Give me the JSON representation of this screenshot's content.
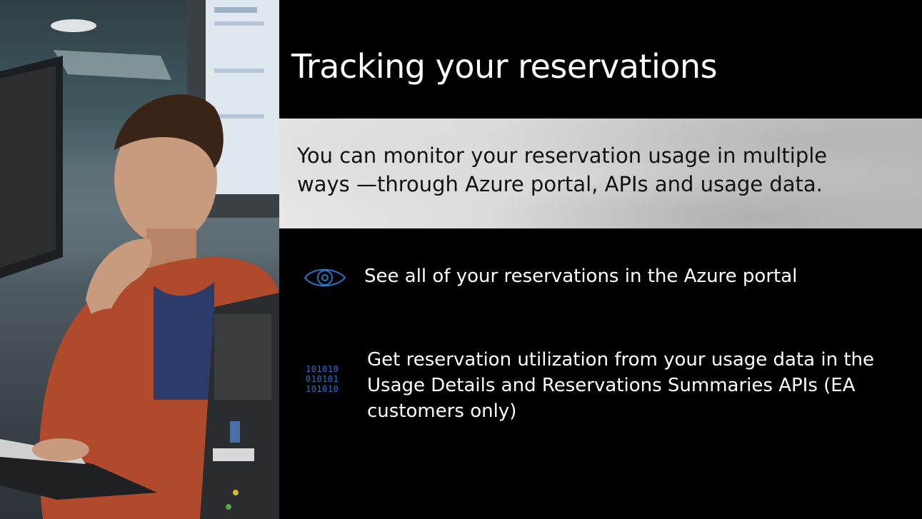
{
  "slide": {
    "title": "Tracking your reservations",
    "intro": "You can monitor your reservation usage in multiple ways —through Azure portal, APIs and usage data.",
    "items": [
      {
        "icon": "eye-icon",
        "text": "See all of your reservations in the Azure portal"
      },
      {
        "icon": "binary-data-icon",
        "text": "Get reservation utilization from your usage data in the Usage Details and Reservations Summaries APIs (EA customers only)"
      }
    ],
    "binary_lines": [
      "101010",
      "010101",
      "101010"
    ]
  },
  "photo": {
    "description_icon": "person-at-computer-photo"
  },
  "colors": {
    "accent": "#2b73c6",
    "background": "#000000",
    "band": "#d9d9d9"
  }
}
